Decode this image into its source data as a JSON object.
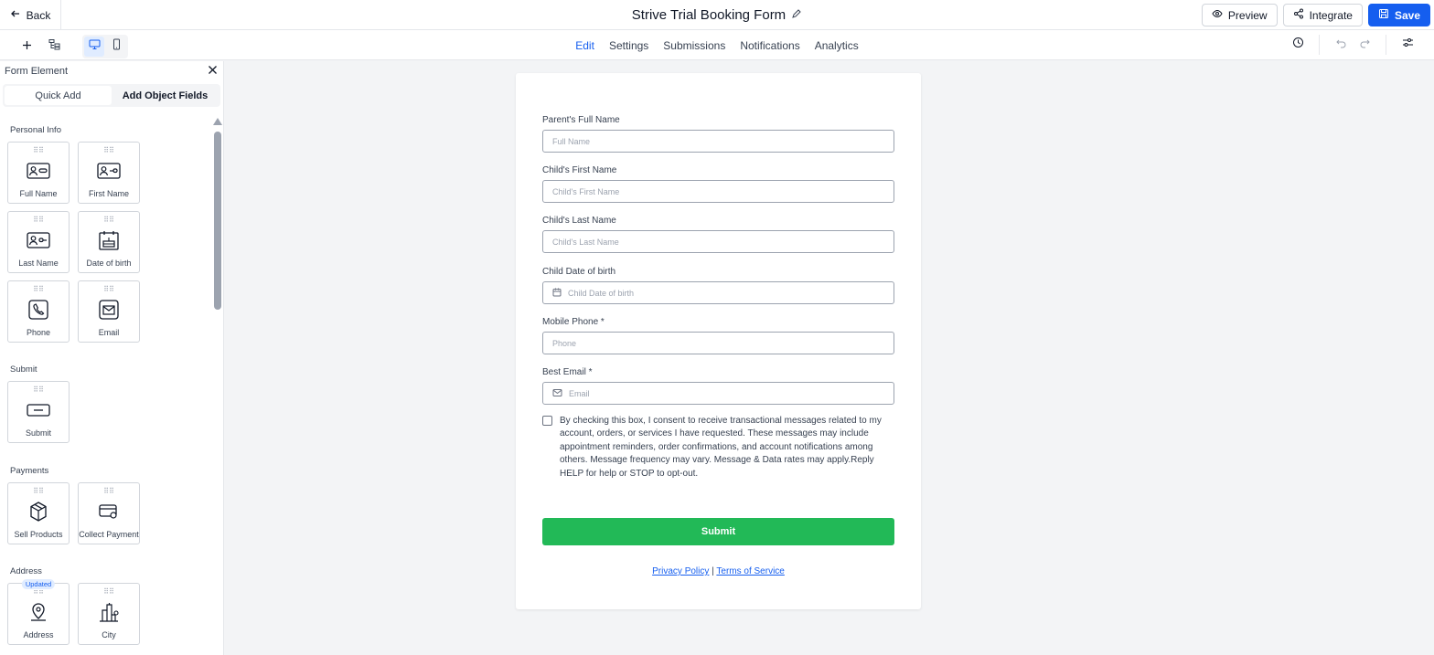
{
  "header": {
    "back_label": "Back",
    "title": "Strive Trial Booking Form",
    "preview_label": "Preview",
    "integrate_label": "Integrate",
    "save_label": "Save"
  },
  "tabs": [
    {
      "label": "Edit",
      "active": true
    },
    {
      "label": "Settings"
    },
    {
      "label": "Submissions"
    },
    {
      "label": "Notifications"
    },
    {
      "label": "Analytics"
    }
  ],
  "sidebar": {
    "title": "Form Element",
    "tab_quick_add": "Quick Add",
    "tab_object_fields": "Add Object Fields",
    "sections": {
      "personal": {
        "label": "Personal Info",
        "items": [
          "Full Name",
          "First Name",
          "Last Name",
          "Date of birth",
          "Phone",
          "Email"
        ]
      },
      "submit": {
        "label": "Submit",
        "items": [
          "Submit"
        ]
      },
      "payments": {
        "label": "Payments",
        "items": [
          "Sell Products",
          "Collect Payment"
        ]
      },
      "address": {
        "label": "Address",
        "items": [
          "Address",
          "City"
        ],
        "badge": "Updated"
      }
    }
  },
  "form": {
    "fields": [
      {
        "label": "Parent's Full Name",
        "placeholder": "Full Name"
      },
      {
        "label": "Child's First Name",
        "placeholder": "Child's First Name"
      },
      {
        "label": "Child's Last Name",
        "placeholder": "Child's Last Name"
      },
      {
        "label": "Child Date of birth",
        "placeholder": "Child Date of birth"
      },
      {
        "label": "Mobile Phone *",
        "placeholder": "Phone"
      },
      {
        "label": "Best Email *",
        "placeholder": "Email"
      }
    ],
    "consent_text": "By checking this box, I consent to receive transactional messages related to my account, orders, or services I have requested. These messages may include appointment reminders, order confirmations, and account notifications among others. Message frequency may vary. Message & Data rates may apply.Reply HELP for help or STOP to opt-out.",
    "submit_label": "Submit",
    "privacy_label": "Privacy Policy",
    "separator": "|",
    "terms_label": "Terms of Service"
  },
  "colors": {
    "accent": "#155eef",
    "submit_green": "#22b957",
    "canvas_bg": "#f3f4f6"
  }
}
